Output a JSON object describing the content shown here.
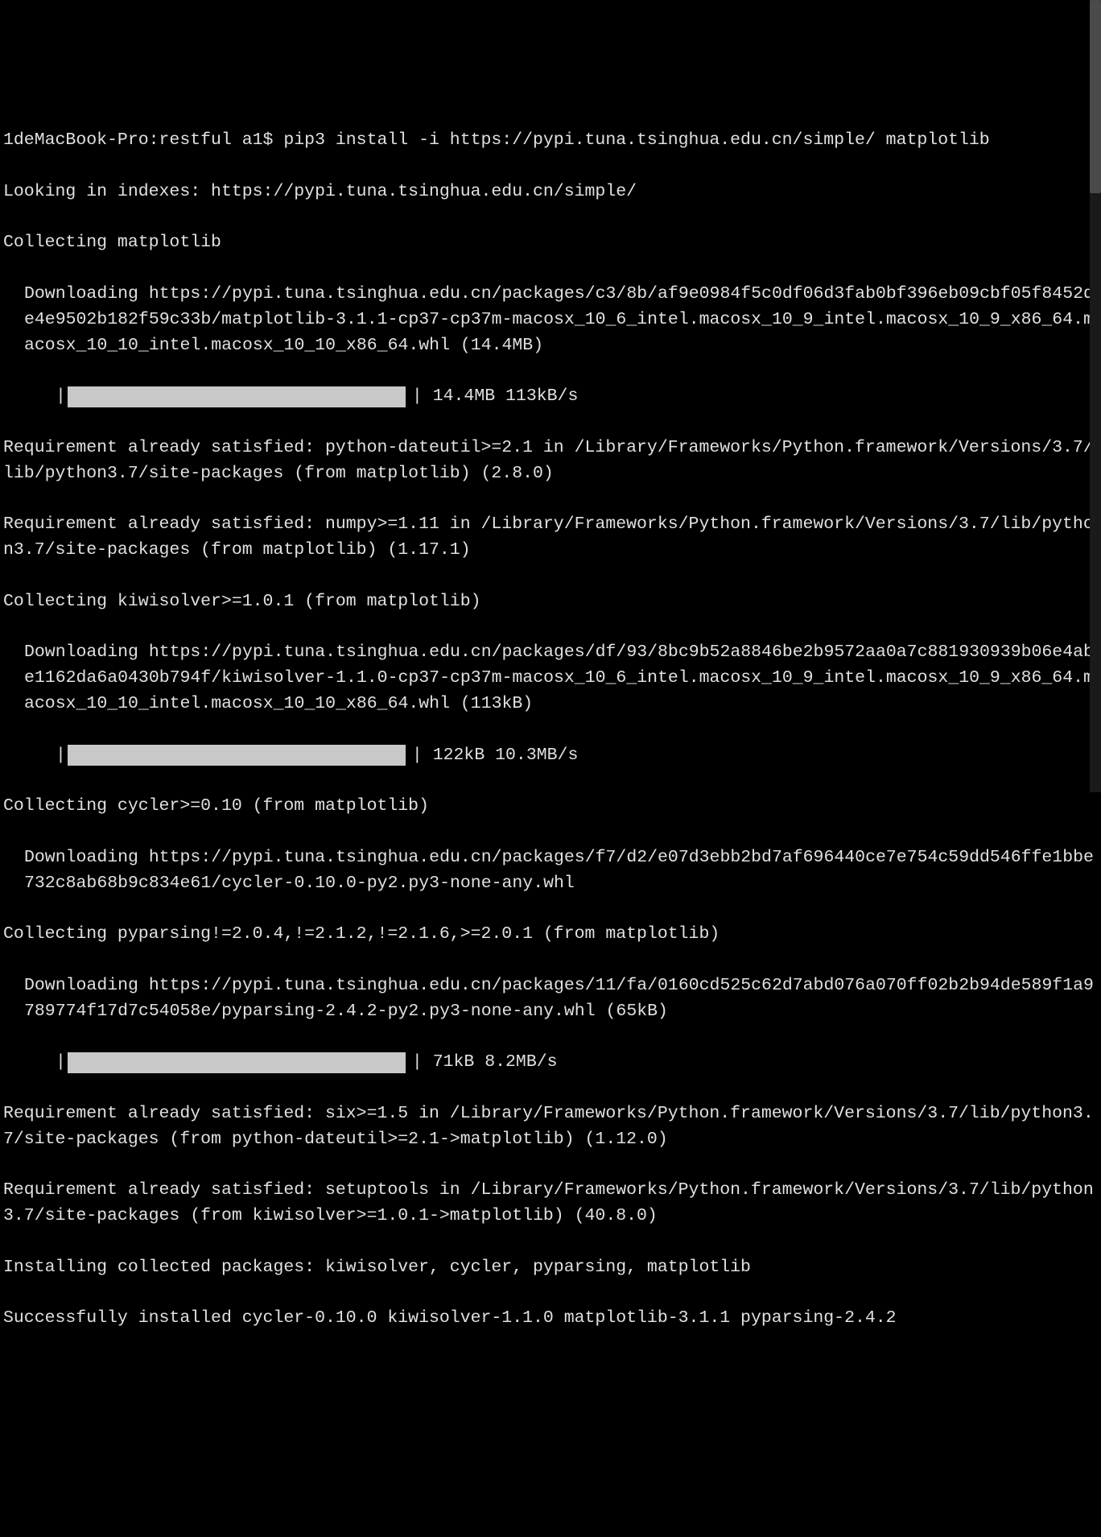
{
  "lines": {
    "prompt": "1deMacBook-Pro:restful a1$ pip3 install -i https://pypi.tuna.tsinghua.edu.cn/simple/ matplotlib",
    "looking": "Looking in indexes: https://pypi.tuna.tsinghua.edu.cn/simple/",
    "collect_matplotlib": "Collecting matplotlib",
    "download_matplotlib": "Downloading https://pypi.tuna.tsinghua.edu.cn/packages/c3/8b/af9e0984f5c0df06d3fab0bf396eb09cbf05f8452de4e9502b182f59c33b/matplotlib-3.1.1-cp37-cp37m-macosx_10_6_intel.macosx_10_9_intel.macosx_10_9_x86_64.macosx_10_10_intel.macosx_10_10_x86_64.whl (14.4MB)",
    "progress1_text": "| 14.4MB 113kB/s",
    "req_dateutil": "Requirement already satisfied: python-dateutil>=2.1 in /Library/Frameworks/Python.framework/Versions/3.7/lib/python3.7/site-packages (from matplotlib) (2.8.0)",
    "req_numpy": "Requirement already satisfied: numpy>=1.11 in /Library/Frameworks/Python.framework/Versions/3.7/lib/python3.7/site-packages (from matplotlib) (1.17.1)",
    "collect_kiwi": "Collecting kiwisolver>=1.0.1 (from matplotlib)",
    "download_kiwi": "Downloading https://pypi.tuna.tsinghua.edu.cn/packages/df/93/8bc9b52a8846be2b9572aa0a7c881930939b06e4abe1162da6a0430b794f/kiwisolver-1.1.0-cp37-cp37m-macosx_10_6_intel.macosx_10_9_intel.macosx_10_9_x86_64.macosx_10_10_intel.macosx_10_10_x86_64.whl (113kB)",
    "progress2_text": "| 122kB 10.3MB/s",
    "collect_cycler": "Collecting cycler>=0.10 (from matplotlib)",
    "download_cycler": "Downloading https://pypi.tuna.tsinghua.edu.cn/packages/f7/d2/e07d3ebb2bd7af696440ce7e754c59dd546ffe1bbe732c8ab68b9c834e61/cycler-0.10.0-py2.py3-none-any.whl",
    "collect_pyparsing": "Collecting pyparsing!=2.0.4,!=2.1.2,!=2.1.6,>=2.0.1 (from matplotlib)",
    "download_pyparsing": "Downloading https://pypi.tuna.tsinghua.edu.cn/packages/11/fa/0160cd525c62d7abd076a070ff02b2b94de589f1a9789774f17d7c54058e/pyparsing-2.4.2-py2.py3-none-any.whl (65kB)",
    "progress3_text": "| 71kB 8.2MB/s",
    "req_six": "Requirement already satisfied: six>=1.5 in /Library/Frameworks/Python.framework/Versions/3.7/lib/python3.7/site-packages (from python-dateutil>=2.1->matplotlib) (1.12.0)",
    "req_setuptools": "Requirement already satisfied: setuptools in /Library/Frameworks/Python.framework/Versions/3.7/lib/python3.7/site-packages (from kiwisolver>=1.0.1->matplotlib) (40.8.0)",
    "installing": "Installing collected packages: kiwisolver, cycler, pyparsing, matplotlib",
    "success": "Successfully installed cycler-0.10.0 kiwisolver-1.1.0 matplotlib-3.1.1 pyparsing-2.4.2",
    "pipe": "|"
  }
}
